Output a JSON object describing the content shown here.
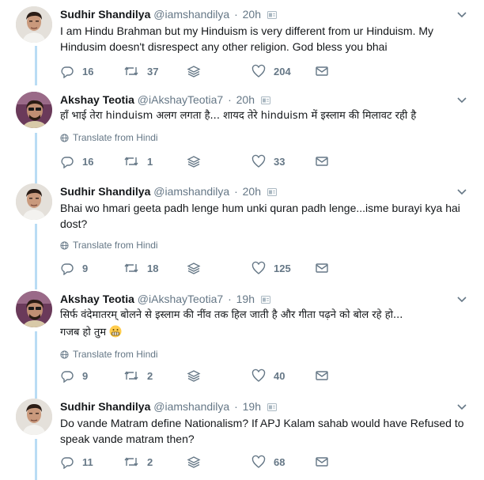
{
  "tweets": [
    {
      "author": "Sudhir Shandilya",
      "handle": "@iamshandilya",
      "time": "20h",
      "text1": "I am Hindu Brahman but my Hinduism is very different from ur Hinduism. My",
      "text2": "Hindusim doesn't disrespect any other religion. God bless you bhai",
      "translate": "",
      "replies": "16",
      "retweets": "37",
      "likes": "204"
    },
    {
      "author": "Akshay Teotia",
      "handle": "@iAkshayTeotia7",
      "time": "20h",
      "text1": "हाँ भाई तेरा hinduism अलग लगता है... शायद तेरे hinduism में इस्लाम की मिलावट रही है",
      "text2": "",
      "translate": "Translate from Hindi",
      "replies": "16",
      "retweets": "1",
      "likes": "33"
    },
    {
      "author": "Sudhir Shandilya",
      "handle": "@iamshandilya",
      "time": "20h",
      "text1": "Bhai wo hmari geeta padh lenge hum unki quran padh lenge...isme burayi kya hai",
      "text2": "dost?",
      "translate": "Translate from Hindi",
      "replies": "9",
      "retweets": "18",
      "likes": "125"
    },
    {
      "author": "Akshay Teotia",
      "handle": "@iAkshayTeotia7",
      "time": "19h",
      "text1": "सिर्फ वंदेमातरम् बोलने से इस्लाम की नींव तक हिल जाती है और गीता पढ़ने को बोल रहे हो...",
      "text2": "गजब हो तुम",
      "translate": "Translate from Hindi",
      "replies": "9",
      "retweets": "2",
      "likes": "40"
    },
    {
      "author": "Sudhir Shandilya",
      "handle": "@iamshandilya",
      "time": "19h",
      "text1": "Do vande Matram define Nationalism? If APJ Kalam sahab would have Refused to",
      "text2": "speak vande matram then?",
      "translate": "",
      "replies": "11",
      "retweets": "2",
      "likes": "68"
    }
  ],
  "colors": {
    "thread": "#b9dcf4",
    "muted": "#657786",
    "text": "#14171a"
  },
  "icons": [
    "reply-icon",
    "retweet-icon",
    "stack-icon",
    "heart-icon",
    "dm-icon",
    "chevron-down-icon",
    "globe-icon",
    "grimace-emoji"
  ]
}
